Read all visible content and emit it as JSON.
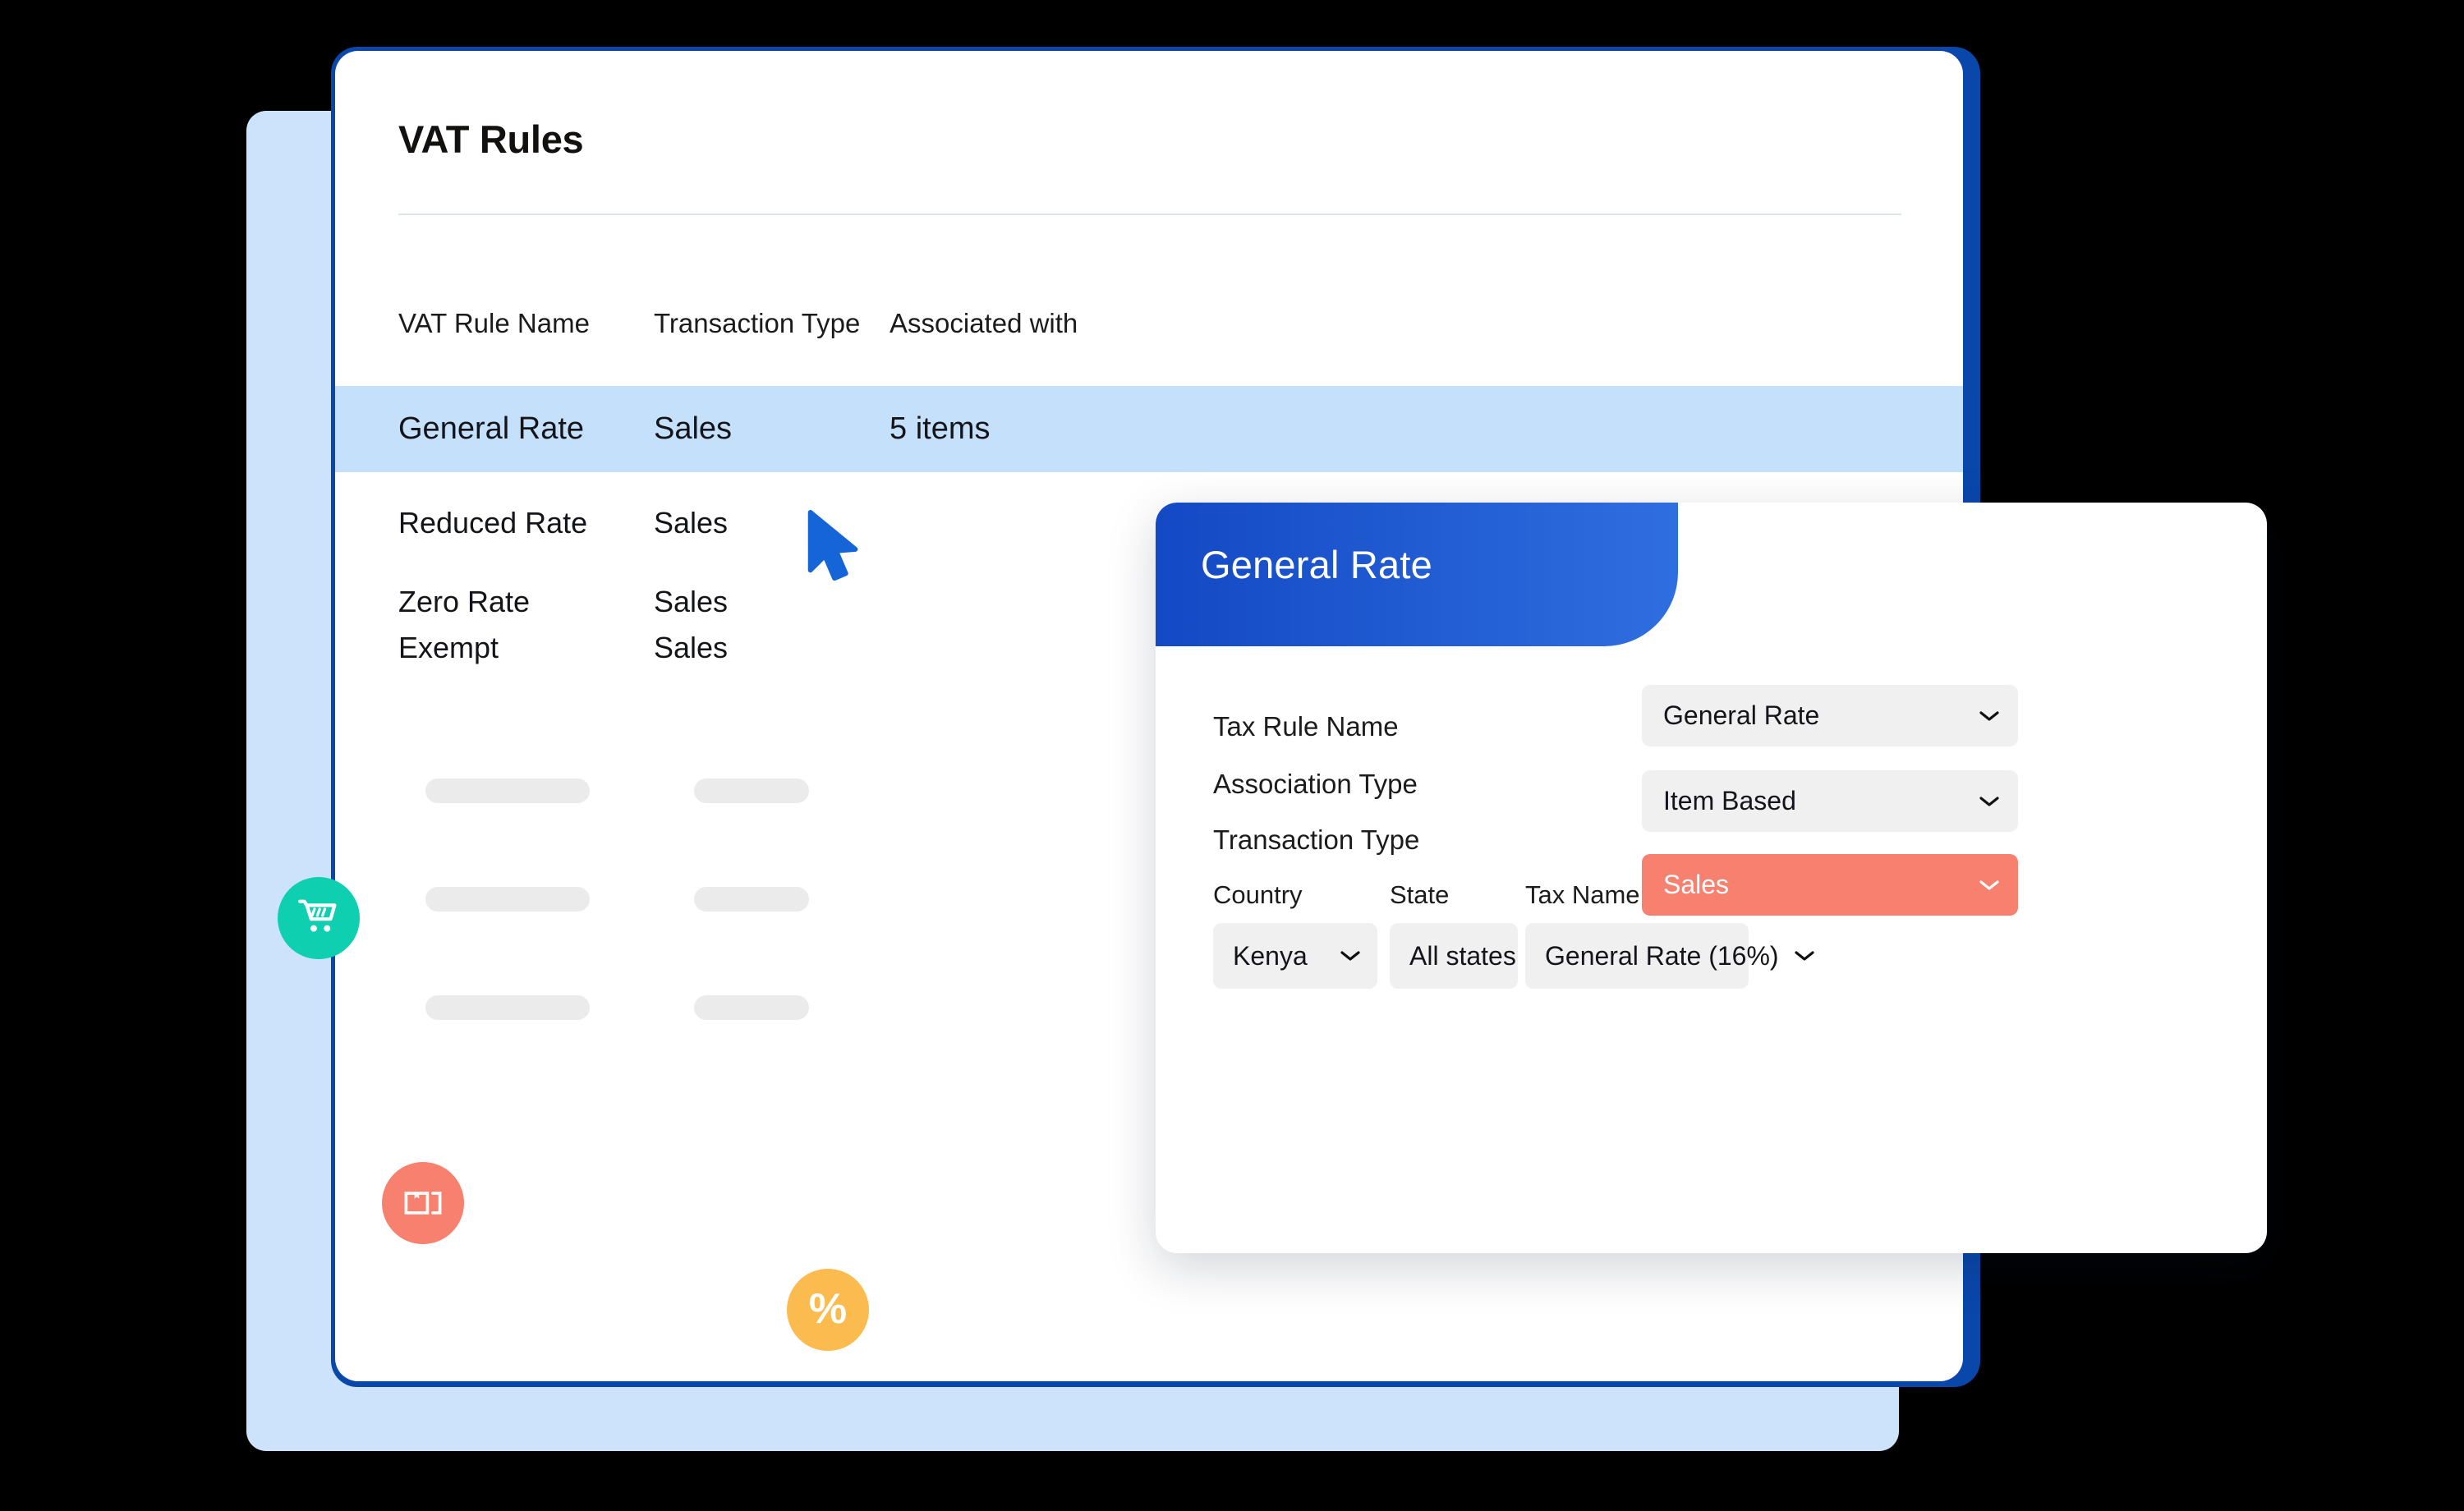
{
  "window": {
    "page_title": "VAT Rules"
  },
  "table": {
    "columns": [
      "VAT Rule Name",
      "Transaction Type",
      "Associated with"
    ],
    "rows": [
      {
        "name": "General Rate",
        "transaction_type": "Sales",
        "associated_with": "5 items",
        "selected": true
      },
      {
        "name": "Reduced Rate",
        "transaction_type": "Sales",
        "associated_with": "",
        "selected": false
      },
      {
        "name": "Zero Rate",
        "transaction_type": "Sales",
        "associated_with": "",
        "selected": false
      },
      {
        "name": "Exempt",
        "transaction_type": "Sales",
        "associated_with": "",
        "selected": false
      }
    ],
    "placeholder_rows": 3
  },
  "badges": [
    {
      "icon": "shopping-cart-icon",
      "color": "#0ecfb0",
      "glyph": ""
    },
    {
      "icon": "package-box-icon",
      "color": "#f7806f",
      "glyph": ""
    },
    {
      "icon": "percent-icon",
      "color": "#fbbb4e",
      "glyph": "%"
    }
  ],
  "detail_panel": {
    "title": "General Rate",
    "fields": [
      {
        "label": "Tax Rule Name",
        "value": "General Rate",
        "accent": false
      },
      {
        "label": "Association Type",
        "value": "Item Based",
        "accent": false
      },
      {
        "label": "Transaction Type",
        "value": "Sales",
        "accent": true
      }
    ],
    "sub_fields": [
      {
        "label": "Country",
        "value": "Kenya"
      },
      {
        "label": "State",
        "value": "All states"
      },
      {
        "label": "Tax Name",
        "value": "General Rate (16%)"
      }
    ]
  },
  "colors": {
    "brand_blue": "#0a47ab",
    "header_gradient_start": "#1349c4",
    "header_gradient_end": "#2f6ee0",
    "row_highlight": "#c5e0fa",
    "card_backdrop": "#cde2fb",
    "accent_coral": "#f7806f",
    "accent_teal": "#0ecfb0",
    "accent_yellow": "#fbbb4e",
    "cursor_blue": "#1565d8",
    "skeleton_gray": "#ebebeb",
    "dropdown_gray": "#f0f0f0"
  }
}
